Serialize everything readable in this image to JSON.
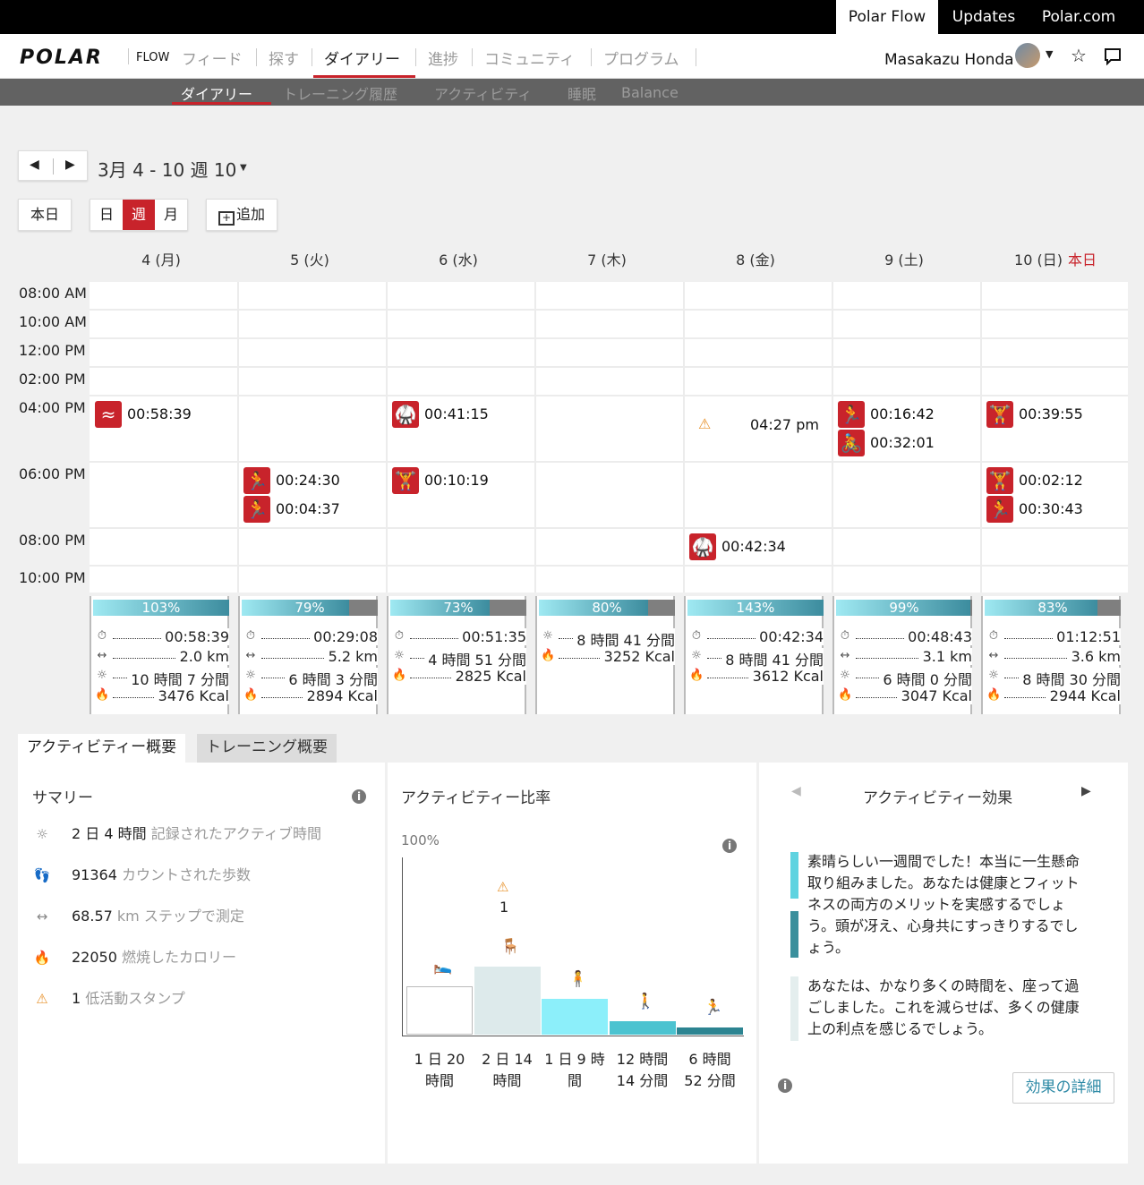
{
  "top_bar": {
    "links": [
      "Polar Flow",
      "Updates",
      "Polar.com"
    ]
  },
  "nav": {
    "logo": "POLAR",
    "flow": "FLOW",
    "items": [
      "フィード",
      "探す",
      "ダイアリー",
      "進捗",
      "コミュニティ",
      "プログラム"
    ],
    "user": "Masakazu Honda"
  },
  "subnav": {
    "items": [
      "ダイアリー",
      "トレーニング履歴",
      "アクティビティ",
      "睡眠",
      "Balance"
    ]
  },
  "date_range": "3月 4 - 10 週 10",
  "controls": {
    "today": "本日",
    "day": "日",
    "week": "週",
    "month": "月",
    "add": "追加"
  },
  "days": [
    {
      "label": "4 (月)",
      "today_tag": ""
    },
    {
      "label": "5 (火)",
      "today_tag": ""
    },
    {
      "label": "6 (水)",
      "today_tag": ""
    },
    {
      "label": "7 (木)",
      "today_tag": ""
    },
    {
      "label": "8 (金)",
      "today_tag": ""
    },
    {
      "label": "9 (土)",
      "today_tag": ""
    },
    {
      "label": "10 (日)",
      "today_tag": "本日"
    }
  ],
  "time_labels": [
    "08:00 AM",
    "10:00 AM",
    "12:00 PM",
    "02:00 PM",
    "04:00 PM",
    "06:00 PM",
    "08:00 PM",
    "10:00 PM"
  ],
  "events": [
    {
      "day": 0,
      "slot": "04:00 PM",
      "icon": "swim-icon",
      "duration": "00:58:39"
    },
    {
      "day": 1,
      "slot": "06:00 PM",
      "icon": "run-icon",
      "duration": "00:24:30"
    },
    {
      "day": 1,
      "slot": "06:00 PM",
      "icon": "run-icon",
      "duration": "00:04:37"
    },
    {
      "day": 2,
      "slot": "04:00 PM",
      "icon": "martial-arts-icon",
      "duration": "00:41:15"
    },
    {
      "day": 2,
      "slot": "06:00 PM",
      "icon": "strength-icon",
      "duration": "00:10:19"
    },
    {
      "day": 4,
      "slot": "04:00 PM",
      "icon": "inactivity-stamp-icon",
      "duration": "04:27 pm"
    },
    {
      "day": 4,
      "slot": "08:00 PM",
      "icon": "martial-arts-icon",
      "duration": "00:42:34"
    },
    {
      "day": 5,
      "slot": "04:00 PM",
      "icon": "run-icon",
      "duration": "00:16:42"
    },
    {
      "day": 5,
      "slot": "04:00 PM",
      "icon": "cycling-icon",
      "duration": "00:32:01"
    },
    {
      "day": 6,
      "slot": "04:00 PM",
      "icon": "strength-icon",
      "duration": "00:39:55"
    },
    {
      "day": 6,
      "slot": "06:00 PM",
      "icon": "strength-icon",
      "duration": "00:02:12"
    },
    {
      "day": 6,
      "slot": "06:00 PM",
      "icon": "treadmill-icon",
      "duration": "00:30:43"
    }
  ],
  "day_summaries": [
    {
      "goal_pct": 103,
      "goal_label": "103%",
      "rows": [
        {
          "icon": "stopwatch-icon",
          "value": "00:58:39"
        },
        {
          "icon": "distance-icon",
          "value": "2.0 km"
        },
        {
          "icon": "active-time-icon",
          "value": "10 時間 7 分間"
        },
        {
          "icon": "calories-icon",
          "value": "3476 Kcal"
        }
      ]
    },
    {
      "goal_pct": 79,
      "goal_label": "79%",
      "rows": [
        {
          "icon": "stopwatch-icon",
          "value": "00:29:08"
        },
        {
          "icon": "distance-icon",
          "value": "5.2 km"
        },
        {
          "icon": "active-time-icon",
          "value": "6 時間 3 分間"
        },
        {
          "icon": "calories-icon",
          "value": "2894 Kcal"
        }
      ]
    },
    {
      "goal_pct": 73,
      "goal_label": "73%",
      "rows": [
        {
          "icon": "stopwatch-icon",
          "value": "00:51:35"
        },
        {
          "icon": "active-time-icon",
          "value": "4 時間 51 分間"
        },
        {
          "icon": "calories-icon",
          "value": "2825 Kcal"
        }
      ]
    },
    {
      "goal_pct": 80,
      "goal_label": "80%",
      "rows": [
        {
          "icon": "active-time-icon",
          "value": "8 時間 41 分間"
        },
        {
          "icon": "calories-icon",
          "value": "3252 Kcal"
        }
      ]
    },
    {
      "goal_pct": 143,
      "goal_label": "143%",
      "rows": [
        {
          "icon": "stopwatch-icon",
          "value": "00:42:34"
        },
        {
          "icon": "active-time-icon",
          "value": "8 時間 41 分間"
        },
        {
          "icon": "calories-icon",
          "value": "3612 Kcal"
        }
      ]
    },
    {
      "goal_pct": 99,
      "goal_label": "99%",
      "rows": [
        {
          "icon": "stopwatch-icon",
          "value": "00:48:43"
        },
        {
          "icon": "distance-icon",
          "value": "3.1 km"
        },
        {
          "icon": "active-time-icon",
          "value": "6 時間 0 分間"
        },
        {
          "icon": "calories-icon",
          "value": "3047 Kcal"
        }
      ]
    },
    {
      "goal_pct": 83,
      "goal_label": "83%",
      "rows": [
        {
          "icon": "stopwatch-icon",
          "value": "01:12:51"
        },
        {
          "icon": "distance-icon",
          "value": "3.6 km"
        },
        {
          "icon": "active-time-icon",
          "value": "8 時間 30 分間"
        },
        {
          "icon": "calories-icon",
          "value": "2944 Kcal"
        }
      ]
    }
  ],
  "tabs": [
    "アクティビティー概要",
    "トレーニング概要"
  ],
  "summary": {
    "title": "サマリー",
    "rows": [
      {
        "icon": "active-time-icon",
        "value": "2 日 4 時間",
        "label": "記録されたアクティブ時間"
      },
      {
        "icon": "steps-icon",
        "value": "91364",
        "label": "カウントされた歩数"
      },
      {
        "icon": "distance-icon",
        "value": "68.57",
        "label": "km ステップで測定"
      },
      {
        "icon": "calories-icon",
        "value": "22050",
        "label": "燃焼したカロリー"
      },
      {
        "icon": "inactivity-stamp-icon",
        "value": "1",
        "label": "低活動スタンプ"
      }
    ]
  },
  "ratio": {
    "title": "アクティビティー比率",
    "axis_max": "100%",
    "stamp_count": "1",
    "bars": [
      {
        "icon": "rest-icon",
        "label_l1": "1 日 20",
        "label_l2": "時間",
        "hours": 44,
        "color": "#ffffff"
      },
      {
        "icon": "sitting-icon",
        "label_l1": "2 日 14",
        "label_l2": "時間",
        "hours": 62,
        "color": "#ddeaeb"
      },
      {
        "icon": "standing-icon",
        "label_l1": "1 日 9 時",
        "label_l2": "間",
        "hours": 33,
        "color": "#8ceffa"
      },
      {
        "icon": "walking-icon",
        "label_l1": "12 時間",
        "label_l2": "14 分間",
        "hours": 12.2,
        "color": "#4cc3d0"
      },
      {
        "icon": "running-icon",
        "label_l1": "6 時間",
        "label_l2": "52 分間",
        "hours": 6.9,
        "color": "#2c8491"
      }
    ]
  },
  "effect": {
    "title": "アクティビティー効果",
    "para1": "素晴らしい一週間でした！本当に一生懸命取り組みました。あなたは健康とフィットネスの両方のメリットを実感するでしょう。頭が冴え、心身共にすっきりするでしょう。",
    "para2": "あなたは、かなり多くの時間を、座って過ごしました。これを減らせば、多くの健康上の利点を感じるでしょう。",
    "details_button": "効果の詳細"
  },
  "colors": {
    "accent": "#c8232b",
    "bar_grad_start": "#9fe9f2",
    "bar_grad_end": "#3c8c9e",
    "stamp": "#e8932e"
  }
}
